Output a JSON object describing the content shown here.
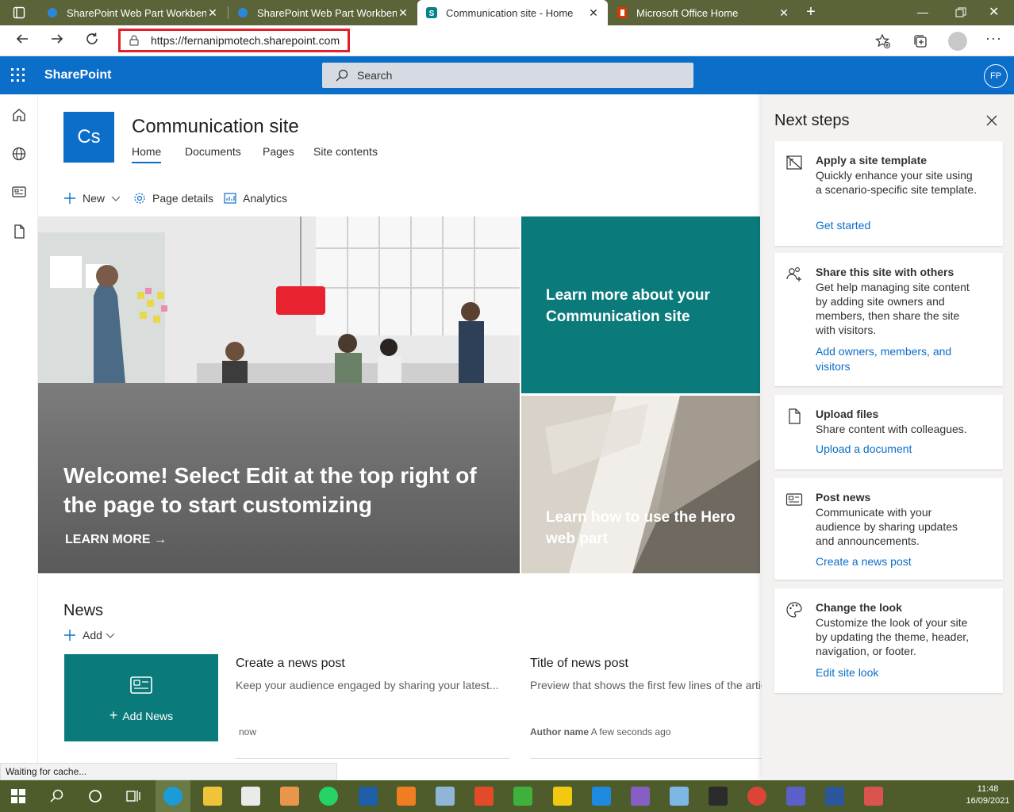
{
  "browser": {
    "tabs": [
      {
        "title": "SharePoint Web Part Workbench",
        "active": false
      },
      {
        "title": "SharePoint Web Part Workbench",
        "active": false
      },
      {
        "title": "Communication site - Home",
        "active": true
      },
      {
        "title": "Microsoft Office Home",
        "active": false
      }
    ],
    "url": "https://fernanipmotech.sharepoint.com"
  },
  "suite": {
    "brand": "SharePoint",
    "search_placeholder": "Search",
    "avatar_initials": "FP"
  },
  "site": {
    "logo_text": "Cs",
    "title": "Communication site",
    "nav": [
      "Home",
      "Documents",
      "Pages",
      "Site contents"
    ]
  },
  "commands": {
    "new": "New",
    "page_details": "Page details",
    "analytics": "Analytics"
  },
  "hero": {
    "main_title": "Welcome! Select Edit at the top right of the page to start customizing",
    "learn_more": "LEARN MORE",
    "tile2": "Learn more about your Communication site",
    "tile3": "Learn how to use the Hero web part"
  },
  "news": {
    "title": "News",
    "add": "Add",
    "add_news": "Add News",
    "posts": [
      {
        "title": "Create a news post",
        "desc": "Keep your audience engaged by sharing your latest...",
        "author": "",
        "time": "now"
      },
      {
        "title": "Title of news post",
        "desc": "Preview that shows the first few lines of the article",
        "author": "Author name",
        "time": "A few seconds ago"
      }
    ]
  },
  "next_steps": {
    "title": "Next steps",
    "cards": [
      {
        "icon": "site-template-icon",
        "title": "Apply a site template",
        "desc": "Quickly enhance your site using a scenario-specific site template.",
        "link": "Get started"
      },
      {
        "icon": "people-add-icon",
        "title": "Share this site with others",
        "desc": "Get help managing site content by adding site owners and members, then share the site with visitors.",
        "link": "Add owners, members, and visitors"
      },
      {
        "icon": "upload-file-icon",
        "title": "Upload files",
        "desc": "Share content with colleagues.",
        "link": "Upload a document"
      },
      {
        "icon": "news-icon",
        "title": "Post news",
        "desc": "Communicate with your audience by sharing updates and announcements.",
        "link": "Create a news post"
      },
      {
        "icon": "palette-icon",
        "title": "Change the look",
        "desc": "Customize the look of your site by updating the theme, header, navigation, or footer.",
        "link": "Edit site look"
      }
    ]
  },
  "status_text": "Waiting for cache...",
  "taskbar": {
    "time": "11:48",
    "date": "16/09/2021"
  },
  "colors": {
    "brand_blue": "#0b6ec9",
    "teal": "#0b7a7a",
    "url_highlight": "#e3202a"
  }
}
